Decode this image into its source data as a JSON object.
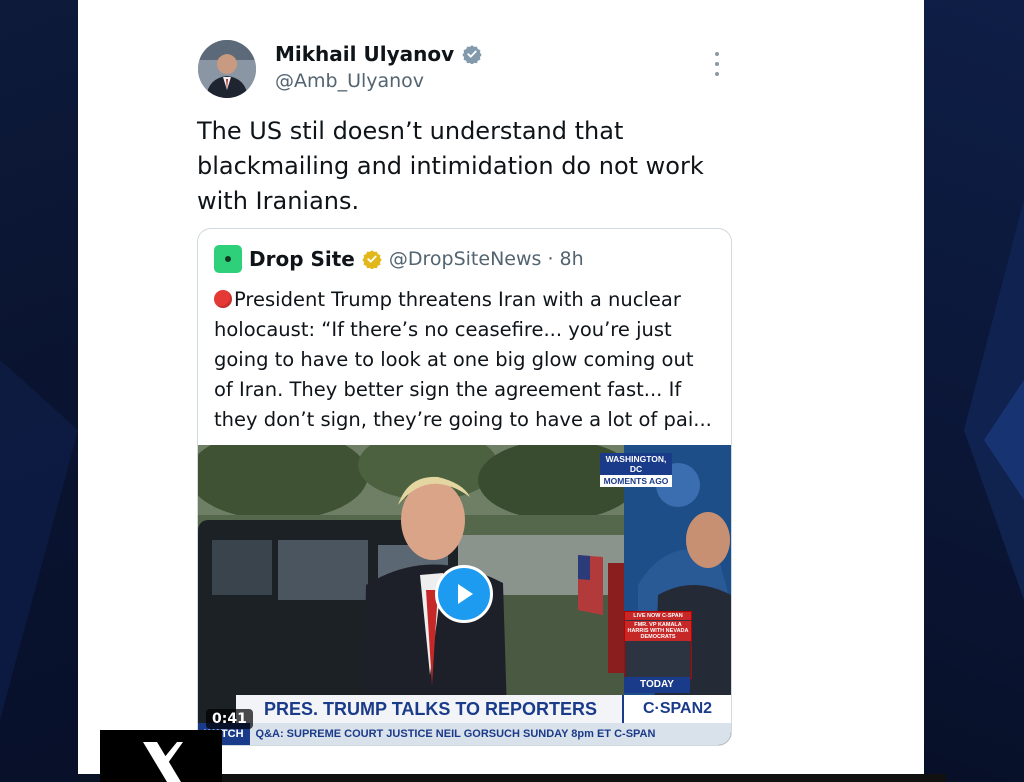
{
  "tweet": {
    "author_name": "Mikhail Ulyanov",
    "author_handle": "@Amb_Ulyanov",
    "text": "The US stil doesn’t understand that blackmailing and intimidation do not work with Iranians."
  },
  "quote": {
    "name": "Drop Site",
    "handle_time": "@DropSiteNews · 8h",
    "text": "President Trump threatens Iran with a nuclear holocaust: “If there’s no ceasefire... you’re just going to have to look at one big glow coming out of Iran. They better sign the agreement fast... If they don’t sign, they’re going to have a lot of pai..."
  },
  "video": {
    "duration": "0:41",
    "headline": "PRES. TRUMP TALKS TO REPORTERS",
    "network": "C·SPAN2",
    "ticker_watch": "WATCH",
    "ticker_text": "Q&A: SUPREME COURT JUSTICE NEIL GORSUCH  SUNDAY 8pm ET  C-SPAN",
    "location_line1": "WASHINGTON, DC",
    "location_line2": "MOMENTS AGO",
    "today_label": "TODAY",
    "live_now_title": "LIVE NOW C-SPAN",
    "live_now_text": "FMR. VP KAMALA HARRIS WITH NEVADA DEMOCRATS"
  },
  "colors": {
    "brand_blue": "#1d9bf0",
    "cspan_blue": "#1a3a8a",
    "verified_gold": "#e2b719",
    "background": "#0a1226"
  }
}
